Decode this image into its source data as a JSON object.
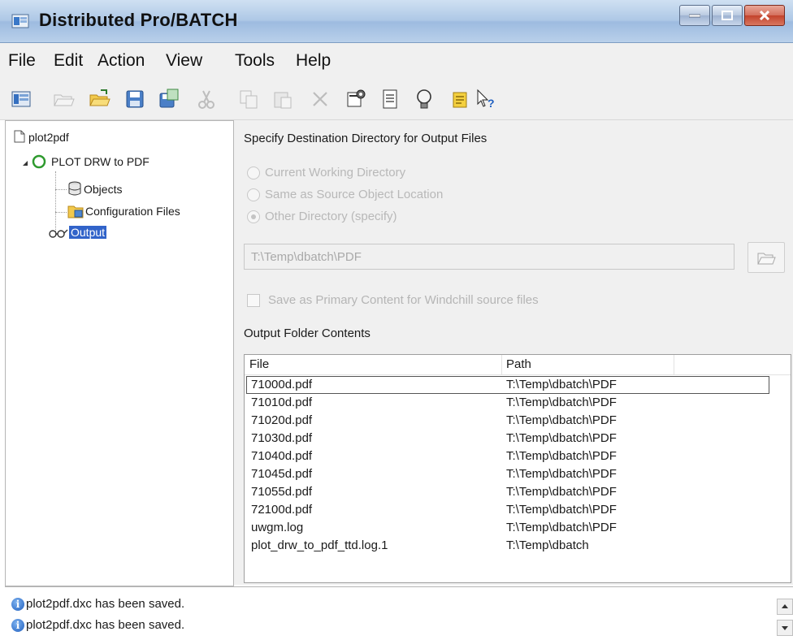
{
  "window": {
    "title": "Distributed Pro/BATCH"
  },
  "menu": [
    "File",
    "Edit",
    "Action",
    "View",
    "Tools",
    "Help"
  ],
  "toolbar_icons": [
    "task-list-icon",
    "open-disabled-icon",
    "open-folder-icon",
    "save-icon",
    "save-as-icon",
    "cut-icon",
    "copy-icon",
    "paste-icon",
    "delete-icon",
    "properties-icon",
    "document-icon",
    "lightbulb-icon",
    "notes-icon",
    "help-pointer-icon"
  ],
  "tree": {
    "root": "plot2pdf",
    "task": "PLOT DRW to PDF",
    "children": [
      "Objects",
      "Configuration Files",
      "Output"
    ]
  },
  "output_panel": {
    "heading": "Specify Destination Directory for Output Files",
    "options": [
      "Current Working Directory",
      "Same as Source Object Location",
      "Other Directory (specify)"
    ],
    "selected_option": "Other Directory (specify)",
    "directory_value": "T:\\Temp\\dbatch\\PDF",
    "save_primary_label": "Save as Primary Content for Windchill source files",
    "folder_contents_label": "Output Folder Contents",
    "columns": [
      "File",
      "Path"
    ],
    "rows": [
      {
        "file": "71000d.pdf",
        "path": "T:\\Temp\\dbatch\\PDF"
      },
      {
        "file": "71010d.pdf",
        "path": "T:\\Temp\\dbatch\\PDF"
      },
      {
        "file": "71020d.pdf",
        "path": "T:\\Temp\\dbatch\\PDF"
      },
      {
        "file": "71030d.pdf",
        "path": "T:\\Temp\\dbatch\\PDF"
      },
      {
        "file": "71040d.pdf",
        "path": "T:\\Temp\\dbatch\\PDF"
      },
      {
        "file": "71045d.pdf",
        "path": "T:\\Temp\\dbatch\\PDF"
      },
      {
        "file": "71055d.pdf",
        "path": "T:\\Temp\\dbatch\\PDF"
      },
      {
        "file": "72100d.pdf",
        "path": "T:\\Temp\\dbatch\\PDF"
      },
      {
        "file": "uwgm.log",
        "path": "T:\\Temp\\dbatch\\PDF"
      },
      {
        "file": "plot_drw_to_pdf_ttd.log.1",
        "path": "T:\\Temp\\dbatch"
      }
    ]
  },
  "status_messages": [
    "plot2pdf.dxc has been saved.",
    "plot2pdf.dxc has been saved."
  ],
  "colors": {
    "titlebar": "#aec8e6",
    "selection": "#3163c9",
    "task_circle": "#2e9a2e",
    "close_button": "#c3432c"
  }
}
